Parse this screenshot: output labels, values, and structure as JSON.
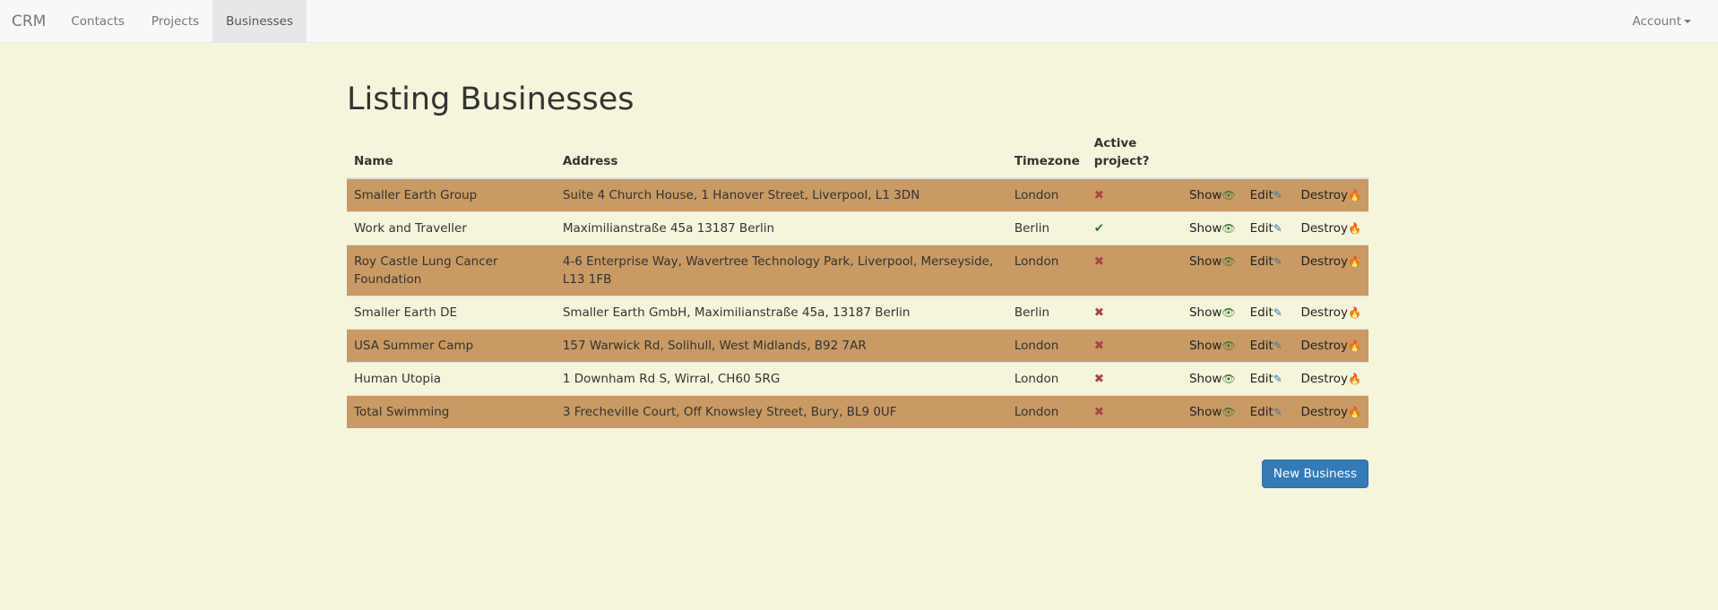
{
  "nav": {
    "brand": "CRM",
    "items": [
      "Contacts",
      "Projects",
      "Businesses"
    ],
    "account": "Account"
  },
  "page": {
    "title": "Listing Businesses",
    "columns": [
      "Name",
      "Address",
      "Timezone",
      "Active project?"
    ],
    "actions": {
      "show": "Show",
      "edit": "Edit",
      "destroy": "Destroy"
    },
    "rows": [
      {
        "name": "Smaller Earth Group",
        "address": "Suite 4 Church House, 1 Hanover Street, Liverpool, L1 3DN",
        "timezone": "London",
        "active": false
      },
      {
        "name": "Work and Traveller",
        "address": "Maximilianstraße 45a 13187 Berlin",
        "timezone": "Berlin",
        "active": true
      },
      {
        "name": "Roy Castle Lung Cancer Foundation",
        "address": "4-6 Enterprise Way, Wavertree Technology Park, Liverpool, Merseyside, L13 1FB",
        "timezone": "London",
        "active": false
      },
      {
        "name": "Smaller Earth DE",
        "address": "Smaller Earth GmbH, Maximilianstraße 45a, 13187 Berlin",
        "timezone": "Berlin",
        "active": false
      },
      {
        "name": "USA Summer Camp",
        "address": "157 Warwick Rd, Solihull, West Midlands, B92 7AR",
        "timezone": "London",
        "active": false
      },
      {
        "name": "Human Utopia",
        "address": "1 Downham Rd S, Wirral, CH60 5RG",
        "timezone": "London",
        "active": false
      },
      {
        "name": "Total Swimming",
        "address": "3 Frecheville Court, Off Knowsley Street, Bury, BL9 0UF",
        "timezone": "London",
        "active": false
      }
    ],
    "new_button": "New Business"
  }
}
